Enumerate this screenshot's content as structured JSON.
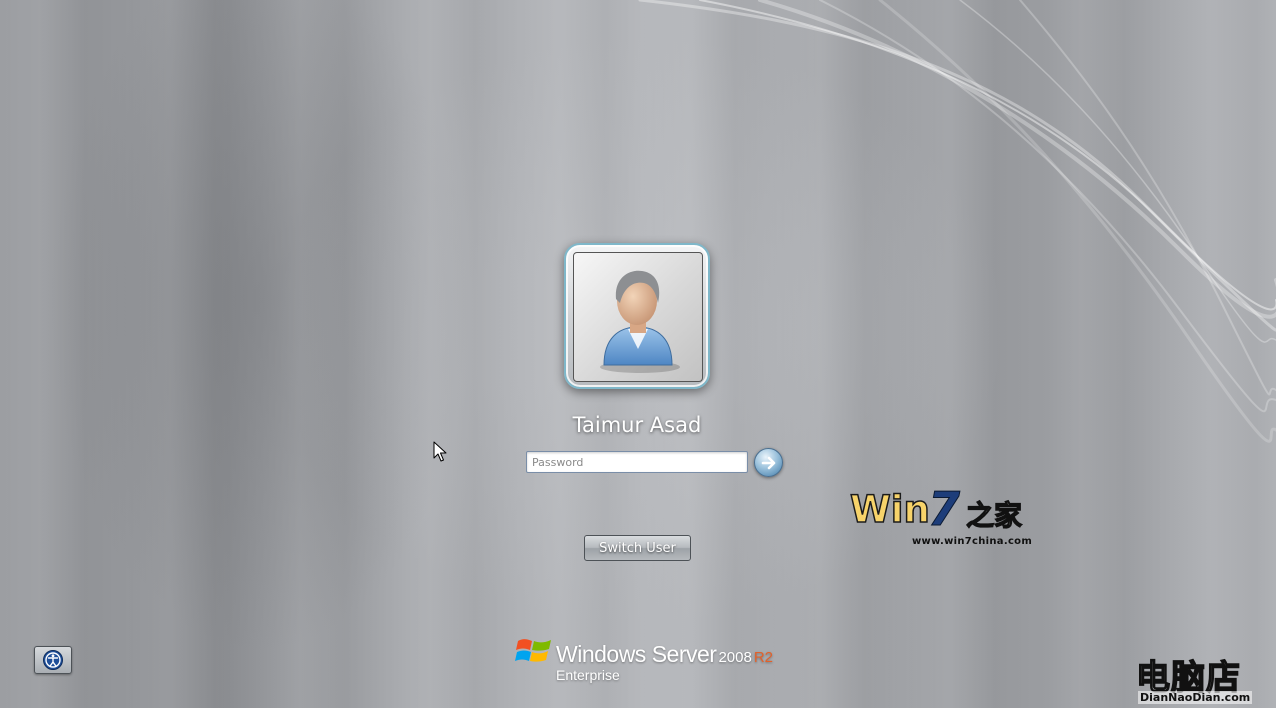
{
  "user": {
    "name": "Taimur Asad"
  },
  "password": {
    "placeholder": "Password",
    "value": ""
  },
  "buttons": {
    "switch_user_label": "Switch User"
  },
  "branding": {
    "product": "Windows Server",
    "version": "2008",
    "release": "R2",
    "edition": "Enterprise"
  },
  "watermarks": {
    "win7": {
      "brand_win": "Win",
      "brand_seven": "7",
      "brand_cjk": "之家",
      "url": "www.win7china.com"
    },
    "diannaodian": {
      "brand_cjk": "电脑店",
      "url": "DianNaoDian.com"
    }
  },
  "icons": {
    "user_avatar": "user-avatar-icon",
    "submit_arrow": "arrow-right-icon",
    "ease_of_access": "ease-of-access-icon",
    "windows_logo": "windows-flag-icon",
    "cursor": "mouse-pointer-icon"
  },
  "colors": {
    "r2_accent": "#e2622b",
    "tile_border": "#7fb7c9",
    "arrow_button": "#3f7aa8"
  }
}
